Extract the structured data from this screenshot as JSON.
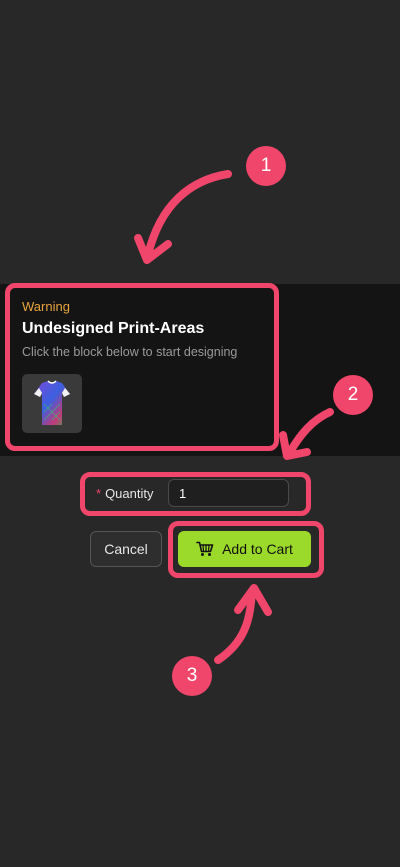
{
  "warning": {
    "label": "Warning",
    "title": "Undesigned Print-Areas",
    "description": "Click the block below to start designing"
  },
  "quantity": {
    "required_mark": "*",
    "label": "Quantity",
    "value": "1"
  },
  "actions": {
    "cancel_label": "Cancel",
    "add_to_cart_label": "Add to Cart"
  },
  "annotations": {
    "step1": "1",
    "step2": "2",
    "step3": "3"
  },
  "colors": {
    "accent": "#f0466b",
    "primary_button": "#9bd92a",
    "warning_text": "#e8a33c",
    "background": "#282828",
    "panel": "#141414"
  },
  "icons": {
    "cart": "shopping-cart-icon",
    "thumbnail": "jersey-thumbnail"
  }
}
